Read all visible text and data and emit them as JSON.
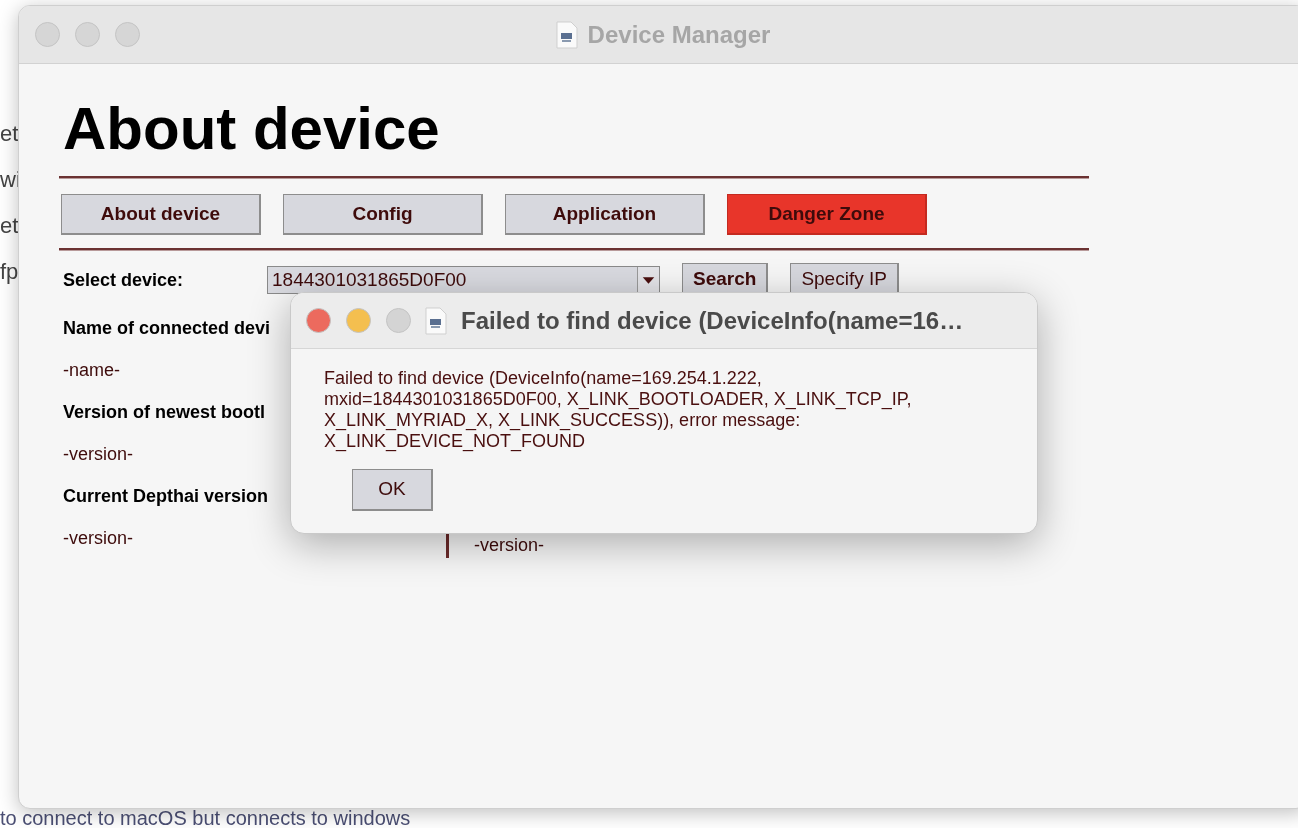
{
  "background_page": {
    "side_fragments": [
      "et",
      "wi",
      "et",
      "fp"
    ],
    "bottom_line": "to connect to macOS but connects to windows"
  },
  "window": {
    "title": "Device Manager",
    "active": false
  },
  "heading": "About device",
  "tabs": [
    {
      "label": "About device",
      "kind": "normal"
    },
    {
      "label": "Config",
      "kind": "normal"
    },
    {
      "label": "Application",
      "kind": "normal"
    },
    {
      "label": "Danger Zone",
      "kind": "danger"
    }
  ],
  "device_selector": {
    "label": "Select device:",
    "value": "1844301031865D0F00",
    "buttons": [
      {
        "label": "Search",
        "bold": true
      },
      {
        "label": "Specify IP",
        "bold": false
      }
    ]
  },
  "info_rows": [
    {
      "label": "Name of connected devi",
      "value": "-name-"
    },
    {
      "label": "Version of newest bootl",
      "value": "-version-"
    },
    {
      "label": "Current Depthai version",
      "value": "-version-"
    }
  ],
  "right_column": {
    "value": "-version-"
  },
  "dialog": {
    "title": "Failed to find device (DeviceInfo(name=16…",
    "active": true,
    "message": "Failed to find device (DeviceInfo(name=169.254.1.222, mxid=1844301031865D0F00, X_LINK_BOOTLOADER, X_LINK_TCP_IP, X_LINK_MYRIAD_X, X_LINK_SUCCESS)), error message: X_LINK_DEVICE_NOT_FOUND",
    "button": "OK"
  }
}
